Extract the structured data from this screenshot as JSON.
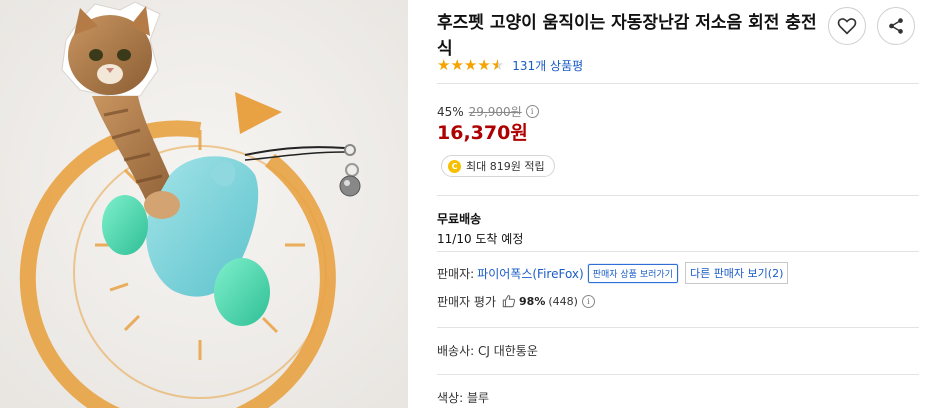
{
  "product": {
    "title": "후즈펫 고양이 움직이는 자동장난감 저소음 회전 충전식",
    "rating": 4.5,
    "review_link": "131개 상품평"
  },
  "pricing": {
    "discount_rate": "45%",
    "original_price": "29,900원",
    "sale_price": "16,370원"
  },
  "reward": {
    "coin_symbol": "C",
    "text": "최대 819원 적립"
  },
  "shipping": {
    "title": "무료배송",
    "arrival": "11/10 도착 예정"
  },
  "seller": {
    "label": "판매자:",
    "name": "파이어폭스(FireFox)",
    "view_products": "판매자 상품 보러가기",
    "other_sellers": "다른 판매자 보기(2)",
    "rating_label": "판매자 평가",
    "rating_percent": "98%",
    "rating_count": "(448)"
  },
  "courier": {
    "text": "배송사: CJ 대한통운"
  },
  "options": {
    "color_text": "색상: 블루"
  },
  "colors": {
    "price_red": "#ae0000",
    "link_blue": "#1a5cc6",
    "star_orange": "#f5a300",
    "toy_teal": "#7fd3d9",
    "toy_green": "#4fcfae",
    "ring_orange": "#e8a243"
  },
  "icons": [
    "heart-icon",
    "share-icon",
    "star-icon",
    "info-icon",
    "coin-icon",
    "thumbs-up-icon"
  ]
}
